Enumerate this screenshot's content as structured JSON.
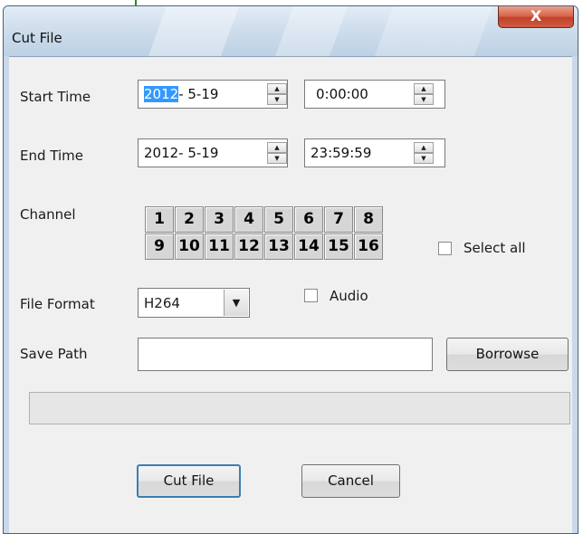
{
  "window": {
    "title": "Cut File",
    "close_glyph": "X"
  },
  "start_time": {
    "label": "Start Time",
    "date_selected": "2012",
    "date_rest": "-  5-19",
    "time": "0:00:00"
  },
  "end_time": {
    "label": "End Time",
    "date": "2012-  5-19",
    "time": "23:59:59"
  },
  "channel": {
    "label": "Channel",
    "row1": [
      "1",
      "2",
      "3",
      "4",
      "5",
      "6",
      "7",
      "8"
    ],
    "row2": [
      "9",
      "10",
      "11",
      "12",
      "13",
      "14",
      "15",
      "16"
    ],
    "select_all_label": "Select all"
  },
  "file_format": {
    "label": "File Format",
    "value": "H264",
    "audio_label": "Audio"
  },
  "save_path": {
    "label": "Save Path",
    "value": "",
    "browse_label": "Borrowse"
  },
  "buttons": {
    "cut": "Cut File",
    "cancel": "Cancel"
  },
  "icons": {
    "spin_up": "▲",
    "spin_down": "▼",
    "dropdown": "▼"
  }
}
